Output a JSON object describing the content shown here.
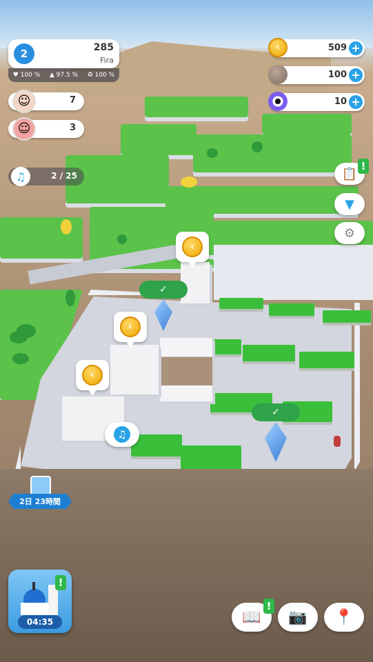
{
  "player": {
    "level": "2",
    "population": "285",
    "town_name": "Fira",
    "stats": [
      {
        "icon": "heart-icon",
        "value": "100 %"
      },
      {
        "icon": "crowd-icon",
        "value": "97.5 %"
      },
      {
        "icon": "recycle-icon",
        "value": "100 %"
      }
    ]
  },
  "residents": [
    {
      "icon": "elder-avatar-icon",
      "count": "7"
    },
    {
      "icon": "woman-hat-avatar-icon",
      "count": "3"
    }
  ],
  "music_progress": "2 / 25",
  "currencies": [
    {
      "icon": "coin-icon",
      "amount": "509"
    },
    {
      "icon": "stone-icon",
      "amount": "100"
    },
    {
      "icon": "evil-eye-icon",
      "amount": "10"
    }
  ],
  "gift_timer": "2日 23時間",
  "landmark_timer": "04:35",
  "colors": {
    "accent": "#2aa3e6",
    "alert": "#2fb84a",
    "grass": "#5bc24a"
  }
}
